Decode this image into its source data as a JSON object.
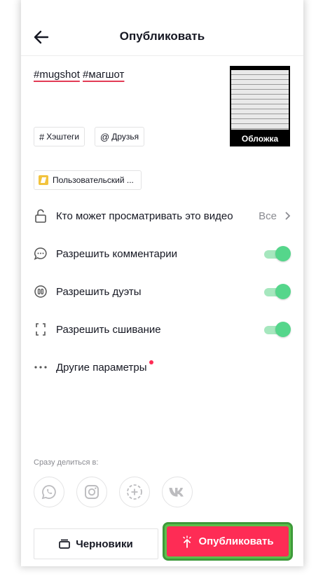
{
  "header": {
    "title": "Опубликовать"
  },
  "caption": {
    "tags": [
      "#mugshot",
      "#магшот"
    ]
  },
  "cover": {
    "label": "Обложка"
  },
  "chips": {
    "hashtags_icon": "#",
    "hashtags": "Хэштеги",
    "friends_icon": "@",
    "friends": "Друзья"
  },
  "effect": {
    "label": "Пользовательский ..."
  },
  "settings": {
    "privacy": {
      "label": "Кто может просматривать это видео",
      "value": "Все"
    },
    "comments": {
      "label": "Разрешить комментарии",
      "enabled": true
    },
    "duets": {
      "label": "Разрешить дуэты",
      "enabled": true
    },
    "stitch": {
      "label": "Разрешить сшивание",
      "enabled": true
    },
    "more": {
      "label": "Другие параметры",
      "has_notification": true
    }
  },
  "share": {
    "label": "Сразу делиться в:",
    "targets": [
      "whatsapp-icon",
      "instagram-icon",
      "add-story-icon",
      "vk-icon"
    ]
  },
  "footer": {
    "drafts": "Черновики",
    "publish": "Опубликовать"
  },
  "colors": {
    "accent": "#fe2c55",
    "toggle_on": "#55d68b",
    "highlight_border": "#3e9a3a"
  }
}
